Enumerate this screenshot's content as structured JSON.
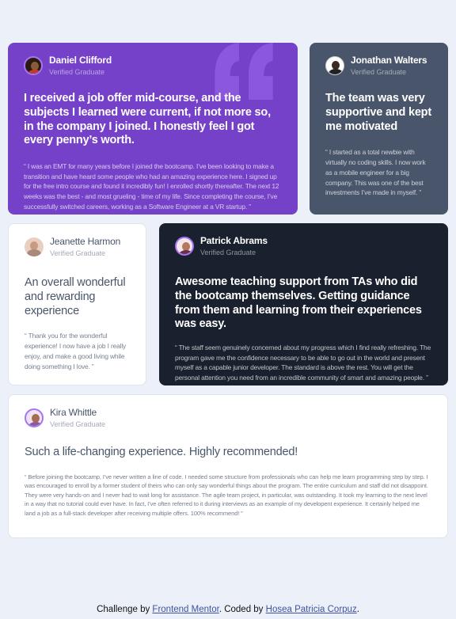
{
  "testimonials": [
    {
      "name": "Daniel Clifford",
      "role": "Verified Graduate",
      "headline": "I received a job offer mid-course, and the subjects I learned were current, if not more so, in the company I joined. I honestly feel I got every penny’s worth.",
      "body": "“ I was an EMT for many years before I joined the bootcamp. I’ve been looking to make a transition and have heard some people who had an amazing experience here. I signed up for the free intro course and found it incredibly fun! I enrolled shortly thereafter. The next 12 weeks was the best - and most grueling - time of my life. Since completing the course, I’ve successfully switched careers, working as a Software Engineer at a VR startup. ”"
    },
    {
      "name": "Jonathan Walters",
      "role": "Verified Graduate",
      "headline": "The team was very supportive and kept me motivated",
      "body": "“ I started as a total newbie with virtually no coding skills. I now work as a mobile engineer for a big company. This was one of the best investments I’ve made in myself. ”"
    },
    {
      "name": "Jeanette Harmon",
      "role": "Verified Graduate",
      "headline": "An overall wonderful and rewarding experience",
      "body": "“ Thank you for the wonderful experience! I now have a job I really enjoy, and make a good living while doing something I love. ”"
    },
    {
      "name": "Patrick Abrams",
      "role": "Verified Graduate",
      "headline": "Awesome teaching support from TAs who did the bootcamp themselves. Getting guidance from them and learning from their experiences was easy.",
      "body": "“ The staff seem genuinely concerned about my progress which I find really refreshing. The program gave me the confidence necessary to be able to go out in the world and present myself as a capable junior developer. The standard is above the rest. You will get the personal attention you need from an incredible community of smart and amazing people. ”"
    },
    {
      "name": "Kira Whittle",
      "role": "Verified Graduate",
      "headline": "Such a life-changing experience. Highly recommended!",
      "body": "“ Before joining the bootcamp, I’ve never written a line of code. I needed some structure from professionals who can help me learn programming step by step. I was encouraged to enroll by a former student of theirs who can only say wonderful things about the program. The entire curriculum and staff did not disappoint. They were very hands-on and I never had to wait long for assistance. The agile team project, in particular, was outstanding. It took my learning to the next level in a way that no tutorial could ever have. In fact, I’ve often referred to it during interviews as an example of my developent experience. It certainly helped me land a job as a full-stack developer after receiving multiple offers. 100% recommend! ”"
    }
  ],
  "footer": {
    "prefix": "Challenge by ",
    "challenge_link": "Frontend Mentor",
    "middle": ". Coded by ",
    "author_link": "Hosea Patricia Corpuz",
    "suffix": "."
  },
  "colors": {
    "purple": "#7541c8",
    "grey_blue": "#48556a",
    "dark": "#19212e",
    "white": "#ffffff",
    "background": "#ecf0f8"
  },
  "icons": [
    "quote-icon"
  ]
}
